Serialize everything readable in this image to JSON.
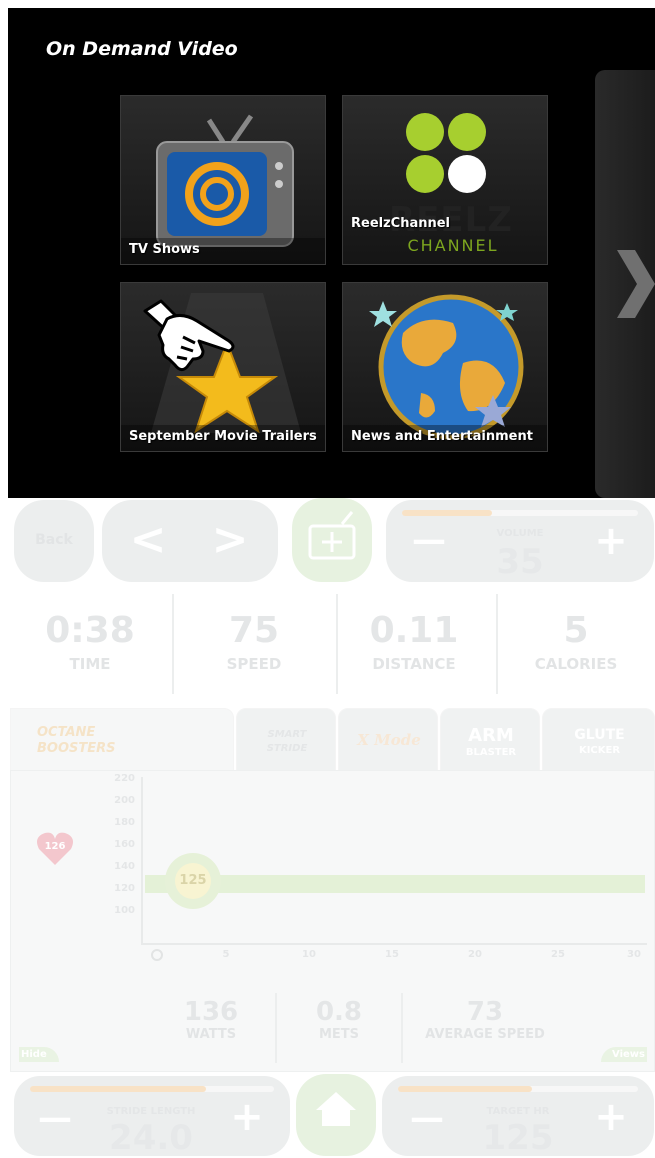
{
  "overlay": {
    "title": "On Demand Video",
    "tiles": [
      {
        "caption": "TV Shows"
      },
      {
        "caption": "ReelzChannel",
        "logo_text_1": "REELZ",
        "logo_text_2": "CHANNEL"
      },
      {
        "caption": "September Movie Trailers"
      },
      {
        "caption": "News and Entertainment"
      }
    ],
    "next_arrow": "❯"
  },
  "top_controls": {
    "back_label": "Back",
    "prev_symbol": "<",
    "next_symbol": ">",
    "volume_label": "VOLUME",
    "volume_value": "35",
    "minus": "—",
    "plus": "+"
  },
  "stats": [
    {
      "value": "0:38",
      "label": "TIME"
    },
    {
      "value": "75",
      "label": "SPEED"
    },
    {
      "value": "0.11",
      "label": "DISTANCE"
    },
    {
      "value": "5",
      "label": "CALORIES"
    }
  ],
  "boosters": {
    "title_line1": "OCTANE",
    "title_line2": "BOOSTERS",
    "tabs": [
      {
        "label_1": "SMART",
        "label_2": "STRIDE"
      },
      {
        "label_1": "X Mode"
      },
      {
        "label_1": "ARM",
        "label_2": "BLASTER"
      },
      {
        "label_1": "GLUTE",
        "label_2": "KICKER"
      }
    ]
  },
  "graph": {
    "heart_value": "126",
    "target_marker": "125",
    "y_ticks": [
      "220",
      "200",
      "180",
      "160",
      "140",
      "120",
      "100"
    ],
    "x_ticks": [
      "5",
      "10",
      "15",
      "20",
      "25",
      "30"
    ],
    "hide_label": "Hide",
    "views_label": "Views"
  },
  "bottom_stats": [
    {
      "value": "136",
      "label": "WATTS"
    },
    {
      "value": "0.8",
      "label": "METS"
    },
    {
      "value": "73",
      "label": "AVERAGE SPEED"
    }
  ],
  "bottom_controls": {
    "stride_label": "STRIDE LENGTH",
    "stride_value": "24.0",
    "target_label": "TARGET HR",
    "target_value": "125",
    "minus": "—",
    "plus": "+"
  }
}
